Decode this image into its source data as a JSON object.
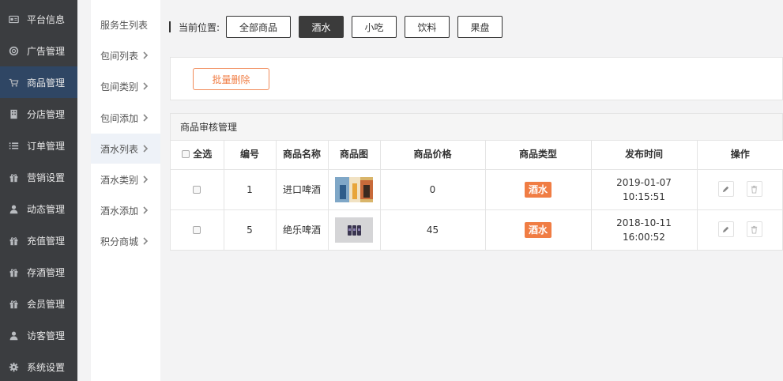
{
  "sidebar": {
    "items": [
      {
        "label": "平台信息",
        "icon": "id-card-icon"
      },
      {
        "label": "广告管理",
        "icon": "lifebuoy-icon"
      },
      {
        "label": "商品管理",
        "icon": "cart-icon",
        "active": true
      },
      {
        "label": "分店管理",
        "icon": "building-icon"
      },
      {
        "label": "订单管理",
        "icon": "list-icon"
      },
      {
        "label": "营销设置",
        "icon": "gift-icon"
      },
      {
        "label": "动态管理",
        "icon": "user-icon"
      },
      {
        "label": "充值管理",
        "icon": "gift-icon"
      },
      {
        "label": "存酒管理",
        "icon": "gift-icon"
      },
      {
        "label": "会员管理",
        "icon": "gift-icon"
      },
      {
        "label": "访客管理",
        "icon": "user-icon"
      },
      {
        "label": "系统设置",
        "icon": "gear-icon"
      }
    ]
  },
  "submenu": {
    "items": [
      {
        "label": "服务生列表",
        "chevron": false
      },
      {
        "label": "包间列表",
        "chevron": true
      },
      {
        "label": "包间类别",
        "chevron": true
      },
      {
        "label": "包间添加",
        "chevron": true
      },
      {
        "label": "酒水列表",
        "chevron": true,
        "active": true
      },
      {
        "label": "酒水类别",
        "chevron": true
      },
      {
        "label": "酒水添加",
        "chevron": true
      },
      {
        "label": "积分商城",
        "chevron": true
      }
    ]
  },
  "breadcrumb": {
    "label": "当前位置:",
    "categories": [
      {
        "label": "全部商品"
      },
      {
        "label": "酒水",
        "active": true
      },
      {
        "label": "小吃"
      },
      {
        "label": "饮料"
      },
      {
        "label": "果盘"
      }
    ]
  },
  "actions": {
    "batch_delete": "批量删除"
  },
  "table": {
    "title": "商品审核管理",
    "headers": {
      "select_all": "全选",
      "id": "编号",
      "name": "商品名称",
      "image": "商品图",
      "price": "商品价格",
      "type": "商品类型",
      "time": "发布时间",
      "ops": "操作"
    },
    "rows": [
      {
        "id": "1",
        "name": "进口啤酒",
        "price": "0",
        "type": "酒水",
        "date": "2019-01-07",
        "time": "10:15:51"
      },
      {
        "id": "5",
        "name": "绝乐啤酒",
        "price": "45",
        "type": "酒水",
        "date": "2018-10-11",
        "time": "16:00:52"
      }
    ]
  },
  "colors": {
    "sidebar_bg": "#3b3d40",
    "sidebar_active": "#2f4664",
    "accent_orange": "#f07d44"
  }
}
